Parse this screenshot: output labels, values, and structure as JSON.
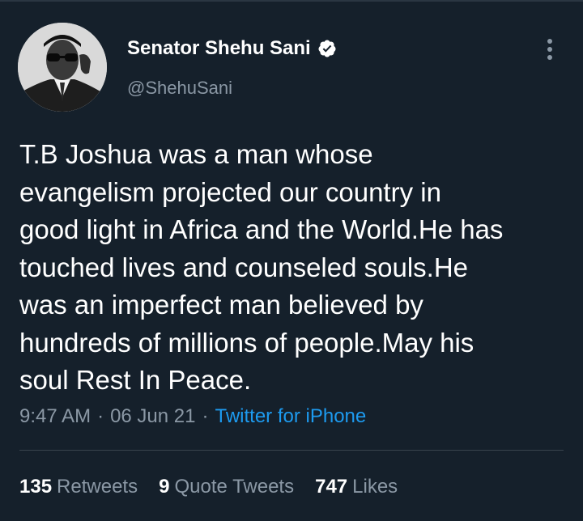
{
  "author": {
    "name": "Senator Shehu Sani",
    "handle": "@ShehuSani",
    "verified_icon": "verified-badge-icon",
    "avatar_icon": "profile-photo"
  },
  "menu": {
    "icon": "more-vertical-icon"
  },
  "tweet": {
    "lines": [
      "T.B Joshua was a man whose",
      "evangelism projected our country in",
      "good light in Africa and the World.He has",
      "touched lives and counseled souls.He",
      "was an imperfect man believed by",
      "hundreds of millions of people.May his",
      "soul Rest In Peace."
    ]
  },
  "meta": {
    "time": "9:47 AM",
    "date": "06 Jun 21",
    "separator": "·",
    "source": "Twitter for iPhone"
  },
  "stats": {
    "retweets_count": "135",
    "retweets_label": "Retweets",
    "quotes_count": "9",
    "quotes_label": "Quote Tweets",
    "likes_count": "747",
    "likes_label": "Likes"
  },
  "colors": {
    "background": "#15202b",
    "text": "#ffffff",
    "secondary": "#8b98a5",
    "link": "#1d9bf0",
    "divider": "#38444d"
  }
}
